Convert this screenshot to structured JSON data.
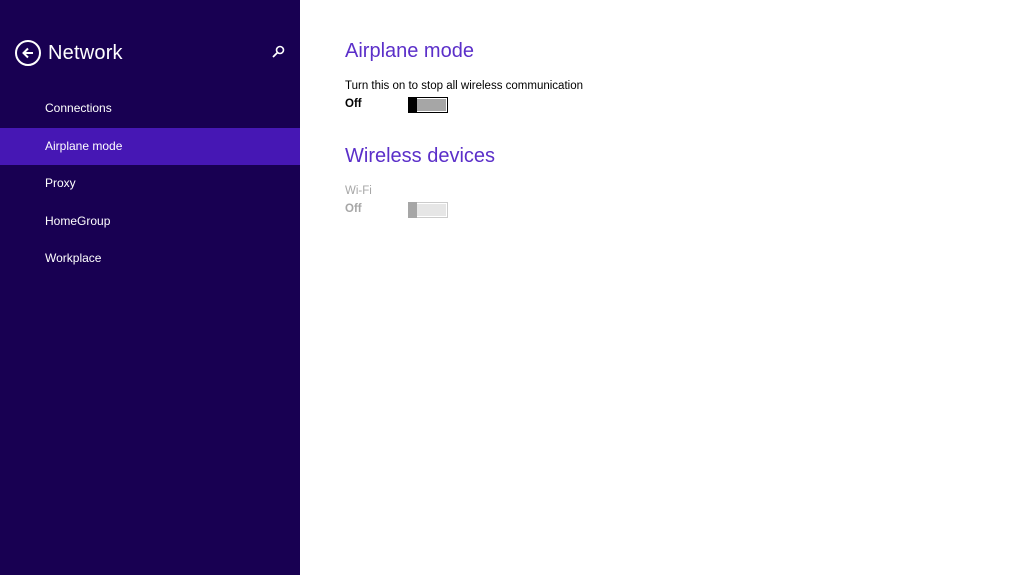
{
  "sidebar": {
    "title": "Network",
    "back_icon": "back-arrow-circle-icon",
    "search_icon": "search-icon",
    "items": [
      {
        "label": "Connections",
        "selected": false
      },
      {
        "label": "Airplane mode",
        "selected": true
      },
      {
        "label": "Proxy",
        "selected": false
      },
      {
        "label": "HomeGroup",
        "selected": false
      },
      {
        "label": "Workplace",
        "selected": false
      }
    ]
  },
  "main": {
    "airplane": {
      "title": "Airplane mode",
      "description": "Turn this on to stop all wireless communication",
      "state_label": "Off",
      "on": false
    },
    "wireless": {
      "title": "Wireless devices",
      "wifi_label": "Wi-Fi",
      "state_label": "Off",
      "on": false,
      "disabled": true
    }
  },
  "colors": {
    "sidebar_bg": "#180052",
    "selected_bg": "#4617b4",
    "accent_text": "#5b2fc9"
  }
}
